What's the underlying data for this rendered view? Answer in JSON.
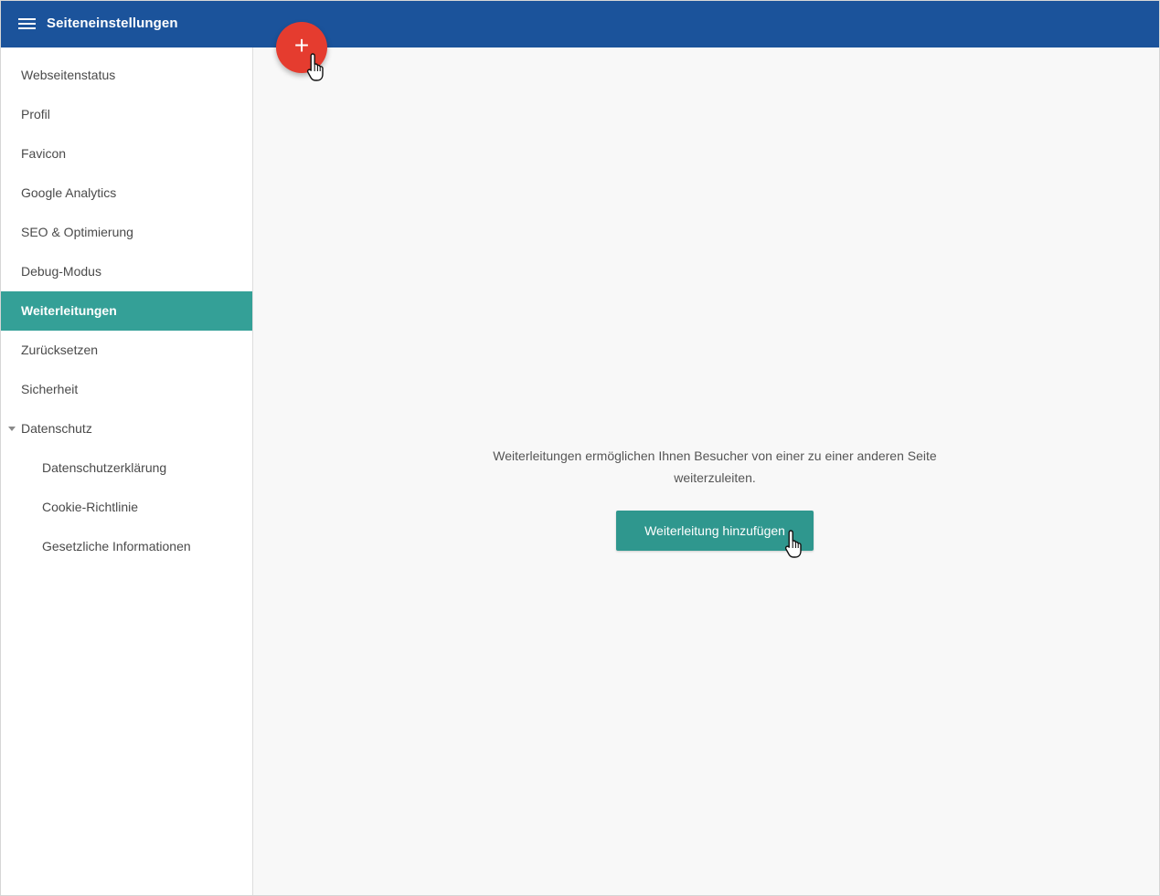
{
  "header": {
    "menu_icon": "hamburger-menu-icon",
    "title": "Seiteneinstellungen"
  },
  "fab": {
    "icon": "plus-icon",
    "label": "+",
    "color": "#e53c2f"
  },
  "sidebar": {
    "items": [
      {
        "label": "Webseitenstatus",
        "active": false,
        "level": 0
      },
      {
        "label": "Profil",
        "active": false,
        "level": 0
      },
      {
        "label": "Favicon",
        "active": false,
        "level": 0
      },
      {
        "label": "Google Analytics",
        "active": false,
        "level": 0
      },
      {
        "label": "SEO & Optimierung",
        "active": false,
        "level": 0
      },
      {
        "label": "Debug-Modus",
        "active": false,
        "level": 0
      },
      {
        "label": "Weiterleitungen",
        "active": true,
        "level": 0
      },
      {
        "label": "Zurücksetzen",
        "active": false,
        "level": 0
      },
      {
        "label": "Sicherheit",
        "active": false,
        "level": 0
      },
      {
        "label": "Datenschutz",
        "active": false,
        "level": 0,
        "expanded": true,
        "caret_icon": "caret-down-icon"
      },
      {
        "label": "Datenschutzerklärung",
        "active": false,
        "level": 1
      },
      {
        "label": "Cookie-Richtlinie",
        "active": false,
        "level": 1
      },
      {
        "label": "Gesetzliche Informationen",
        "active": false,
        "level": 1
      }
    ]
  },
  "main": {
    "empty_text_line1": "Weiterleitungen ermöglichen Ihnen Besucher von einer zu einer anderen Seite",
    "empty_text_line2": "weiterzuleiten.",
    "add_button_label": "Weiterleitung hinzufügen"
  },
  "colors": {
    "header": "#1b539b",
    "active_item": "#34a097",
    "primary_button": "#2f978e"
  },
  "cursor_icon": "hand-pointer-icon"
}
